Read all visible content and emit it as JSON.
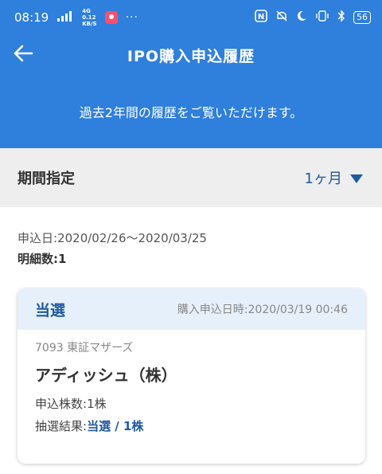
{
  "statusbar": {
    "time": "08:19",
    "net_signal": "4G",
    "net_speed_value": "0.12",
    "net_speed_unit": "KB/S",
    "dots": "···",
    "battery": "56"
  },
  "header": {
    "title": "IPO購入申込履歴",
    "subtitle": "過去2年間の履歴をご覧いただけます。"
  },
  "filter": {
    "label": "期間指定",
    "selected": "1ヶ月"
  },
  "summary": {
    "range_label": "申込日:",
    "range_value": "2020/02/26〜2020/03/25",
    "count_label": "明細数:",
    "count_value": "1"
  },
  "cards": [
    {
      "status": "当選",
      "date_label": "購入申込日時:",
      "date_value": "2020/03/19 00:46",
      "code_market": "7093 東証マザーズ",
      "name": "アディッシュ（株）",
      "qty_label": "申込株数:",
      "qty_value": "1株",
      "result_label": "抽選結果:",
      "result_value": "当選 / 1株"
    }
  ],
  "colors": {
    "primary": "#2f7fdc",
    "accent_text": "#1f5aa0",
    "card_header_bg": "#e6f0fa",
    "filter_bg": "#eeeeee"
  },
  "icons": {
    "back": "arrow-left-icon",
    "dropdown": "caret-down-icon",
    "nfc": "nfc-icon",
    "mute": "mute-icon",
    "moon": "moon-icon",
    "vibrate": "vibrate-icon",
    "bluetooth": "bluetooth-icon"
  }
}
